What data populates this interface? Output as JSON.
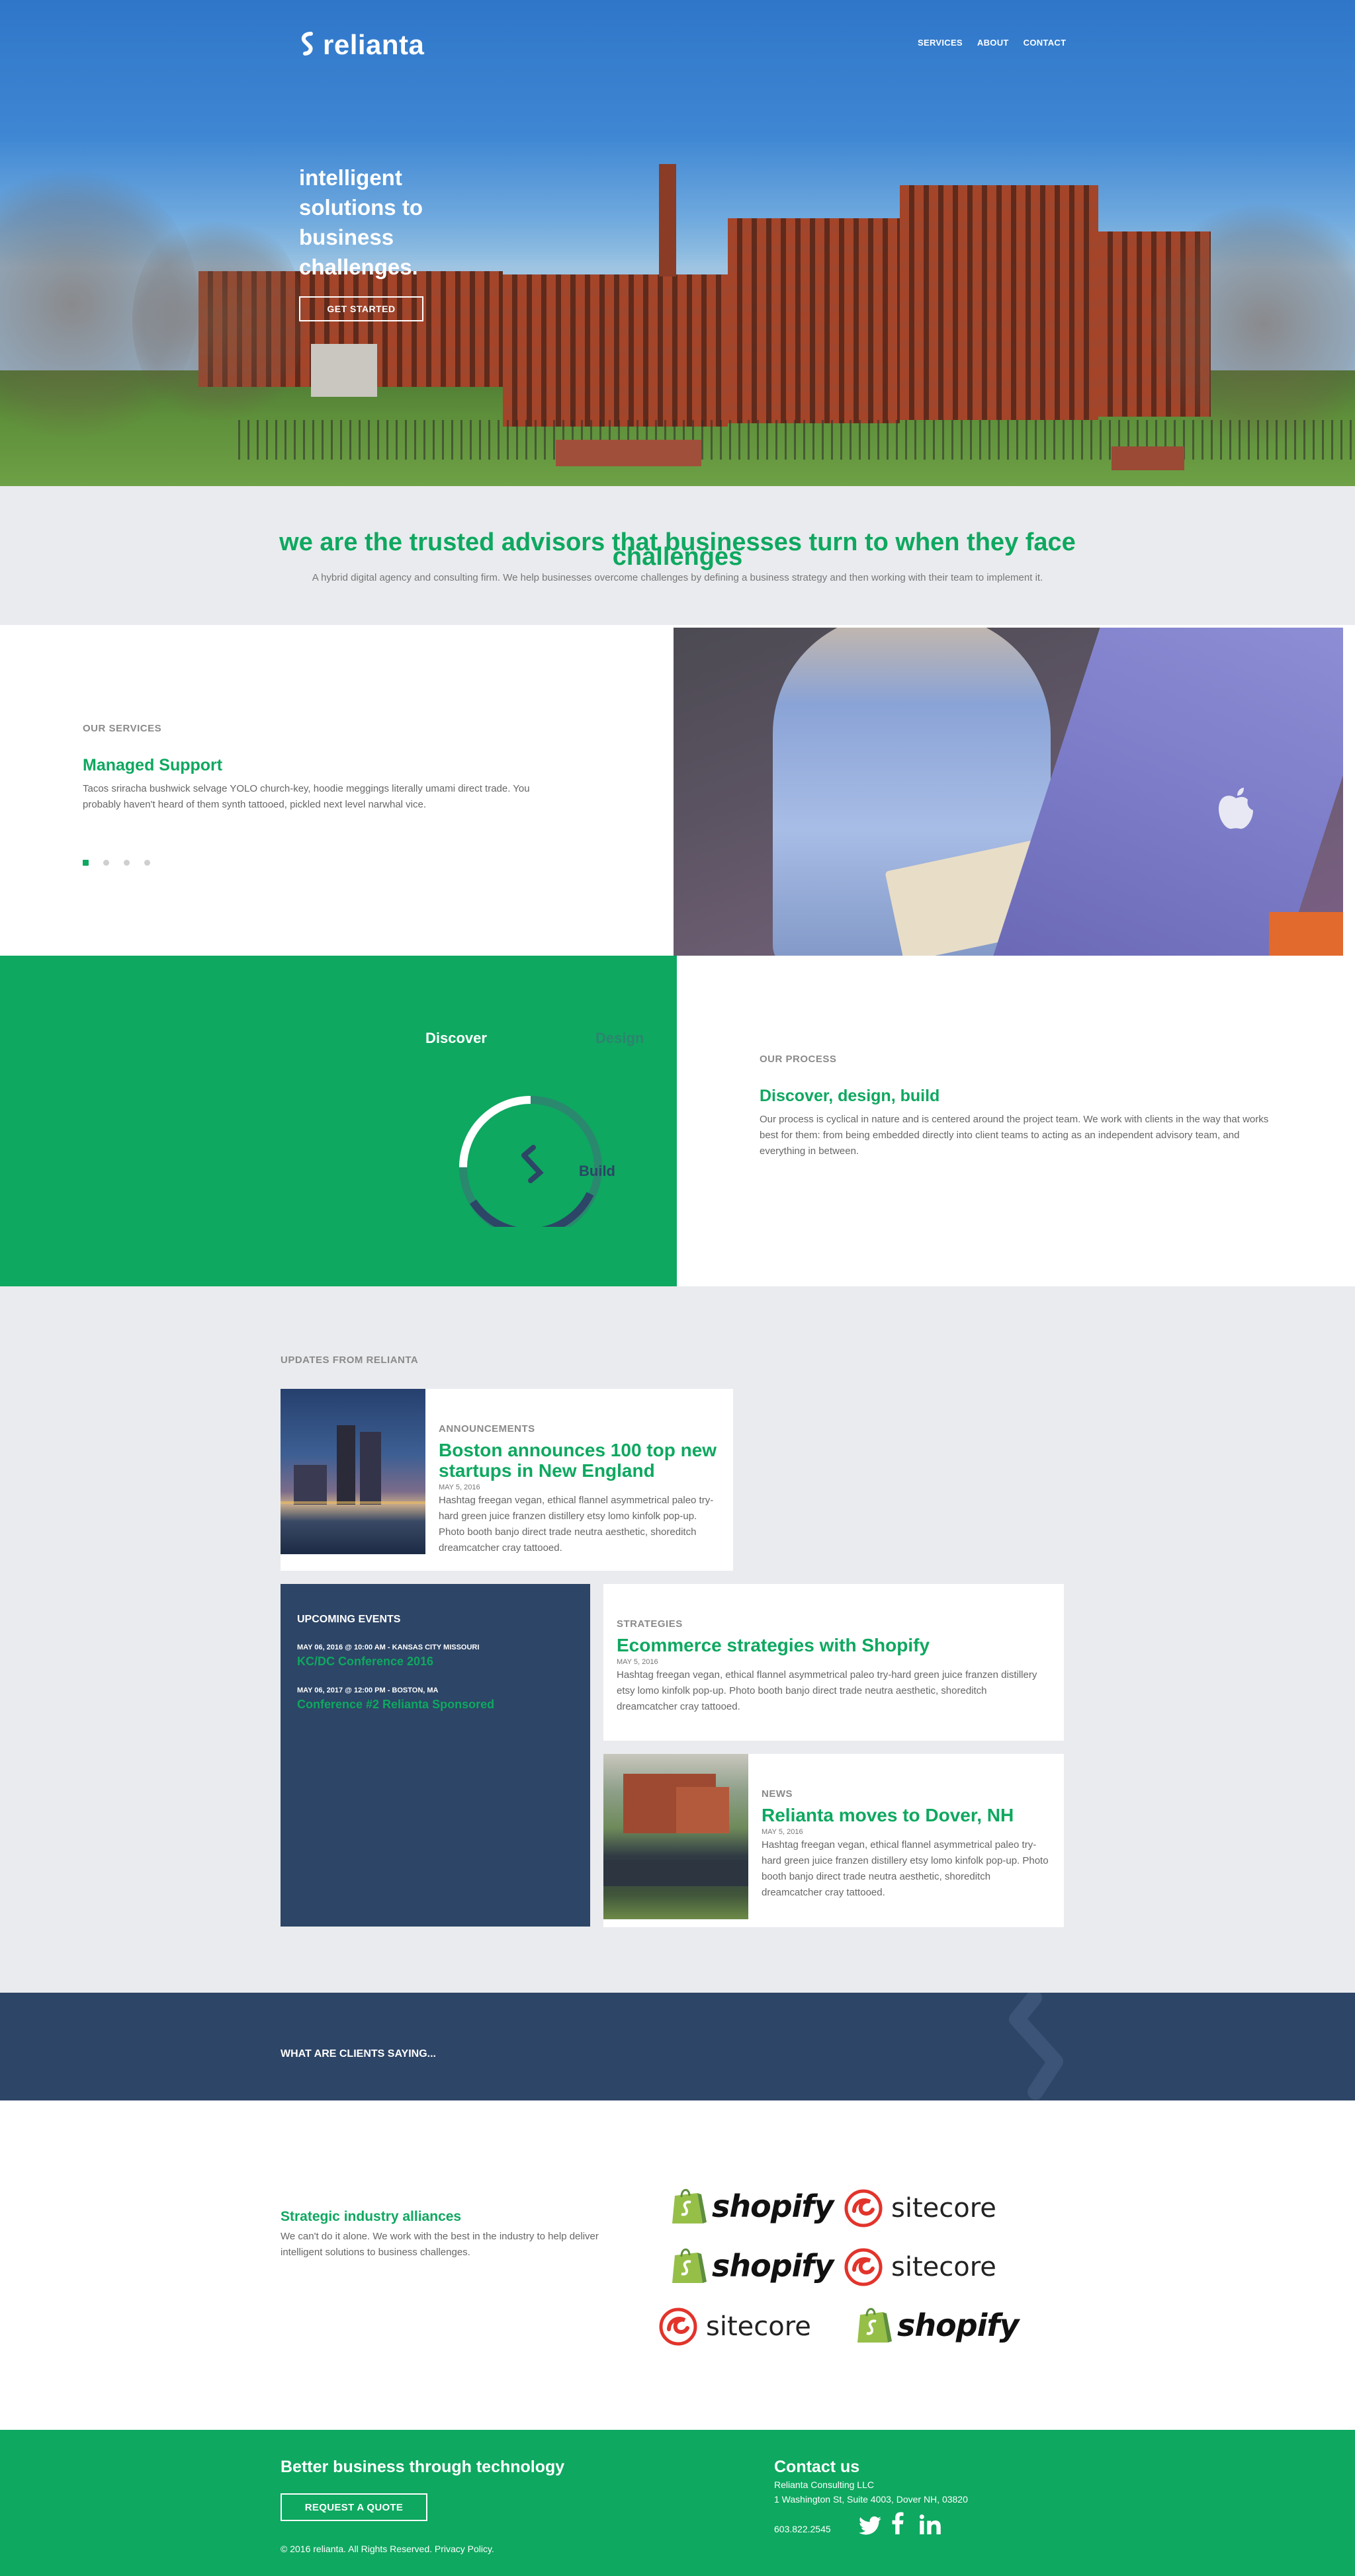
{
  "brand": {
    "name": "relianta"
  },
  "nav": {
    "items": [
      "SERVICES",
      "ABOUT",
      "CONTACT"
    ]
  },
  "hero": {
    "title": "intelligent solutions to business challenges.",
    "cta": "GET STARTED"
  },
  "advisors": {
    "heading": "we are the trusted advisors that businesses turn to when they face challenges",
    "heading_line1": "we are the trusted advisors that businesses turn to when they face",
    "heading_line2": "challenges",
    "text": "A hybrid digital agency and consulting firm. We help businesses overcome challenges by defining a business strategy and then working with their team to implement it."
  },
  "services": {
    "label": "OUR SERVICES",
    "title": "Managed Support",
    "text": "Tacos sriracha bushwick selvage YOLO church-key, hoodie meggings literally umami direct trade. You probably haven't heard of them synth tattooed, pickled next level narwhal vice.",
    "slides": 4,
    "active_slide": 1
  },
  "process": {
    "label": "OUR PROCESS",
    "title": "Discover, design, build",
    "text": "Our process is cyclical in nature and is centered around the project team. We work with clients in the way that works best for them: from being embedded directly into client teams to acting as an independent advisory team, and everything in between.",
    "cycle": {
      "discover": "Discover",
      "design": "Design",
      "build": "Build"
    }
  },
  "updates": {
    "label": "UPDATES FROM RELIANTA",
    "announcement": {
      "category": "ANNOUNCEMENTS",
      "title": "Boston announces 100 top new startups in New England",
      "date": "MAY 5, 2016",
      "body": "Hashtag freegan vegan, ethical flannel asymmetrical paleo try-hard green juice franzen distillery etsy lomo kinfolk pop-up. Photo booth banjo direct trade neutra aesthetic, shoreditch dreamcatcher cray tattooed."
    },
    "events": {
      "heading": "UPCOMING EVENTS",
      "items": [
        {
          "meta": "MAY 06, 2016 @ 10:00 AM - KANSAS CITY MISSOURI",
          "name": "KC/DC Conference 2016"
        },
        {
          "meta": "MAY 06, 2017 @ 12:00 PM - BOSTON, MA",
          "name": "Conference #2 Relianta Sponsored"
        }
      ]
    },
    "strategies": {
      "category": "STRATEGIES",
      "title": "Ecommerce strategies with Shopify",
      "date": "MAY 5, 2016",
      "body": "Hashtag freegan vegan, ethical flannel asymmetrical paleo try-hard green juice franzen distillery etsy lomo kinfolk pop-up. Photo booth banjo direct trade neutra aesthetic, shoreditch dreamcatcher cray tattooed."
    },
    "news": {
      "category": "NEWS",
      "title": "Relianta moves to Dover, NH",
      "date": "MAY 5, 2016",
      "body": "Hashtag freegan vegan, ethical flannel asymmetrical paleo try-hard green juice franzen distillery etsy lomo kinfolk pop-up. Photo booth banjo direct trade neutra aesthetic, shoreditch dreamcatcher cray tattooed."
    }
  },
  "testimonials": {
    "heading": "WHAT ARE CLIENTS SAYING..."
  },
  "alliances": {
    "title": "Strategic industry alliances",
    "text": "We can't do it alone. We work with the best in the industry to help deliver intelligent solutions to business challenges.",
    "logos": [
      "shopify",
      "sitecore",
      "shopify",
      "sitecore",
      "sitecore",
      "shopify"
    ]
  },
  "footer": {
    "tagline": "Better business through technology",
    "cta": "REQUEST A QUOTE",
    "copyright": "© 2016 relianta. All Rights Reserved. Privacy Policy.",
    "contact_heading": "Contact us",
    "company": "Relianta Consulting LLC",
    "address": "1 Washington St, Suite 4003, Dover NH, 03820",
    "phone": "603.822.2545",
    "social": [
      "twitter-icon",
      "facebook-icon",
      "linkedin-icon"
    ]
  },
  "colors": {
    "green": "#0ea860",
    "navy": "#2d4566",
    "light_gray": "#eaebee"
  }
}
